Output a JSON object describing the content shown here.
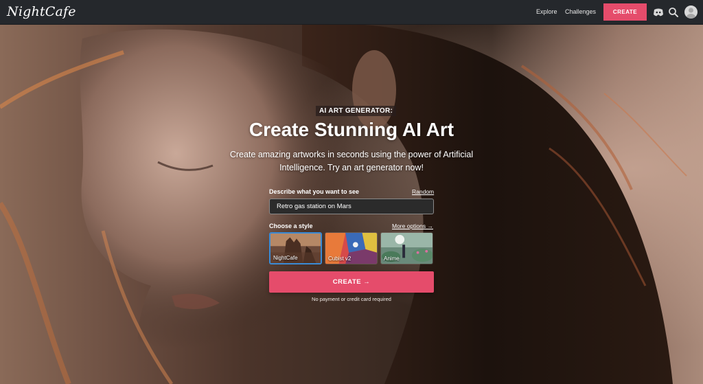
{
  "header": {
    "logo": "NightCafe",
    "nav": {
      "explore": "Explore",
      "challenges": "Challenges",
      "create": "CREATE"
    },
    "icons": [
      "discord-icon",
      "search-icon",
      "avatar"
    ]
  },
  "hero": {
    "badge": "AI ART GENERATOR:",
    "title": "Create Stunning AI Art",
    "subtitle": "Create amazing artworks in seconds using the power of Artificial Intelligence. Try an art generator now!"
  },
  "form": {
    "describe_label": "Describe what you want to see",
    "random_link": "Random",
    "prompt_value": "Retro gas station on Mars",
    "style_label": "Choose a style",
    "more_options": "More options →",
    "styles": [
      {
        "label": "NightCafe",
        "selected": true
      },
      {
        "label": "Cubist v2",
        "selected": false
      },
      {
        "label": "Anime",
        "selected": false
      }
    ],
    "create_button": "CREATE →",
    "disclaimer": "No payment or credit card required"
  },
  "colors": {
    "accent": "#e54c6b",
    "topbar": "#25282c",
    "selected_border": "#3a8bd6"
  }
}
